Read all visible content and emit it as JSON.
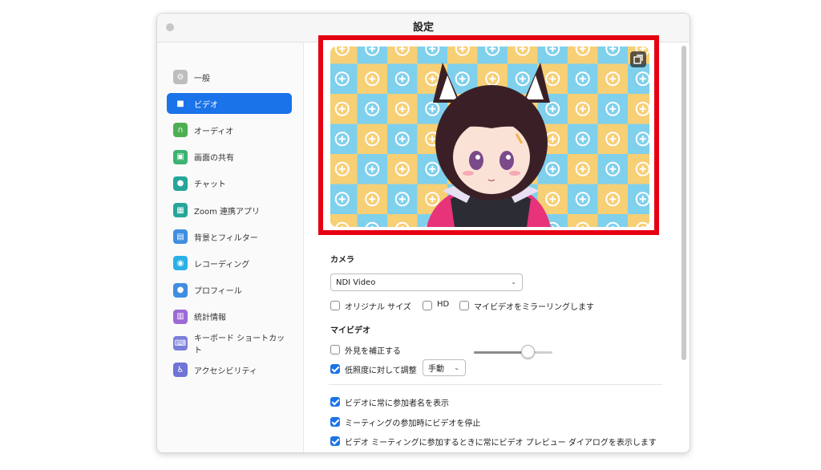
{
  "window": {
    "title": "設定"
  },
  "sidebar": {
    "items": [
      {
        "label": "一般",
        "icon": "gear-icon",
        "color": "#bdbdbd",
        "active": false
      },
      {
        "label": "ビデオ",
        "icon": "video-camera-icon",
        "color": "#1a73e8",
        "active": true
      },
      {
        "label": "オーディオ",
        "icon": "headphones-icon",
        "color": "#4caf50",
        "active": false
      },
      {
        "label": "画面の共有",
        "icon": "screen-share-icon",
        "color": "#3cb371",
        "active": false
      },
      {
        "label": "チャット",
        "icon": "chat-bubble-icon",
        "color": "#26a69a",
        "active": false
      },
      {
        "label": "Zoom 連携アプリ",
        "icon": "apps-icon",
        "color": "#26a69a",
        "active": false
      },
      {
        "label": "背景とフィルター",
        "icon": "background-icon",
        "color": "#3f8ee0",
        "active": false
      },
      {
        "label": "レコーディング",
        "icon": "record-icon",
        "color": "#2bb0e6",
        "active": false
      },
      {
        "label": "プロフィール",
        "icon": "profile-icon",
        "color": "#3f8ee0",
        "active": false
      },
      {
        "label": "統計情報",
        "icon": "statistics-icon",
        "color": "#9c6ad6",
        "active": false
      },
      {
        "label": "キーボード ショートカット",
        "icon": "keyboard-icon",
        "color": "#7b7fd9",
        "active": false
      },
      {
        "label": "アクセシビリティ",
        "icon": "accessibility-icon",
        "color": "#6f74d6",
        "active": false
      }
    ]
  },
  "video": {
    "camera_title": "カメラ",
    "camera_select": "NDI Video",
    "options": {
      "original_size": "オリジナル サイズ",
      "hd": "HD",
      "mirror": "マイビデオをミラーリングします"
    },
    "my_video_title": "マイビデオ",
    "touch_up": "外見を補正する",
    "low_light": "低照度に対して調整",
    "low_light_mode": "手動",
    "low_light_level": 0.68,
    "checkboxes": {
      "show_names": "ビデオに常に参加者名を表示",
      "stop_video": "ミーティングの参加時にビデオを停止",
      "preview_dialog": "ビデオ ミーティングに参加するときに常にビデオ プレビュー ダイアログを表示します"
    }
  },
  "colors": {
    "accent": "#1a73e8",
    "highlight_border": "#e60012",
    "tile_yellow": "#f7cf74",
    "tile_blue": "#7fd0ec"
  }
}
